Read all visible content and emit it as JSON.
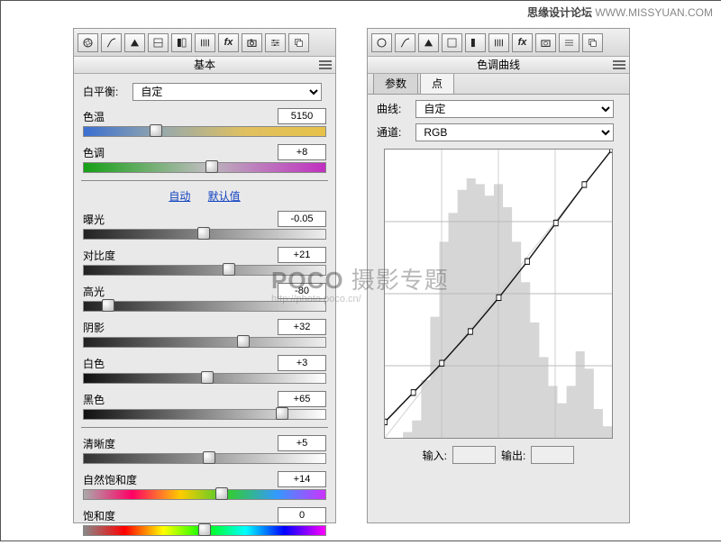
{
  "header": {
    "bold": "思缘设计论坛",
    "url": "WWW.MISSYUAN.COM"
  },
  "basic_panel": {
    "title": "基本",
    "wb_label": "白平衡:",
    "wb_value": "自定",
    "temp_label": "色温",
    "temp_value": "5150",
    "tint_label": "色调",
    "tint_value": "+8",
    "links": {
      "auto": "自动",
      "default": "默认值"
    },
    "exposure_label": "曝光",
    "exposure_value": "-0.05",
    "contrast_label": "对比度",
    "contrast_value": "+21",
    "highlights_label": "高光",
    "highlights_value": "-80",
    "shadows_label": "阴影",
    "shadows_value": "+32",
    "whites_label": "白色",
    "whites_value": "+3",
    "blacks_label": "黑色",
    "blacks_value": "+65",
    "clarity_label": "清晰度",
    "clarity_value": "+5",
    "vibrance_label": "自然饱和度",
    "vibrance_value": "+14",
    "saturation_label": "饱和度",
    "saturation_value": "0"
  },
  "curve_panel": {
    "title": "色调曲线",
    "tabs": {
      "param": "参数",
      "point": "点"
    },
    "curve_label": "曲线:",
    "curve_value": "自定",
    "channel_label": "通道:",
    "channel_value": "RGB",
    "input_label": "输入:",
    "output_label": "输出:",
    "input_value": "",
    "output_value": ""
  },
  "watermark": {
    "big_bold": "POCO",
    "big_rest": " 摄影专题",
    "small": "http://photo.poco.cn/"
  },
  "chart_data": {
    "type": "line",
    "title": "色调曲线",
    "xlabel": "输入",
    "ylabel": "输出",
    "xlim": [
      0,
      255
    ],
    "ylim": [
      0,
      255
    ],
    "series": [
      {
        "name": "RGB",
        "x": [
          0,
          32,
          64,
          96,
          128,
          160,
          192,
          224,
          255
        ],
        "y": [
          14,
          40,
          66,
          94,
          124,
          156,
          190,
          224,
          255
        ]
      }
    ],
    "grid": true,
    "histogram": [
      0.0,
      0.0,
      0.02,
      0.06,
      0.2,
      0.42,
      0.68,
      0.78,
      0.86,
      0.9,
      0.88,
      0.84,
      0.88,
      0.8,
      0.68,
      0.54,
      0.4,
      0.28,
      0.18,
      0.12,
      0.18,
      0.3,
      0.24,
      0.1,
      0.04
    ]
  }
}
